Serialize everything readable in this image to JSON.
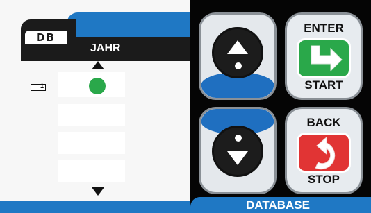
{
  "screen": {
    "db_tab_label": "DB",
    "header_title": "JAHR",
    "battery_label": "1",
    "status_color": "#2aa84a"
  },
  "keypad": {
    "enter_label": "ENTER",
    "start_label": "START",
    "back_label": "BACK",
    "stop_label": "STOP",
    "enter_color": "#2aa84a",
    "back_color": "#e13434",
    "nav_up_icon": "triangle-up-icon",
    "nav_down_icon": "triangle-down-icon",
    "enter_icon": "arrow-down-right-icon",
    "back_icon": "undo-arrow-icon"
  },
  "footer": {
    "mode_label": "DATABASE"
  },
  "colors": {
    "accent_blue": "#1f78c4",
    "panel_dark": "#050505"
  }
}
